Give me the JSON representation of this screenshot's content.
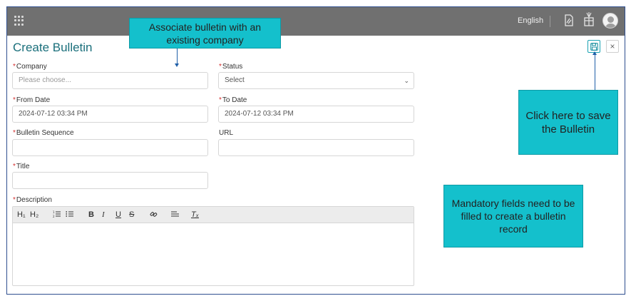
{
  "header": {
    "language": "English"
  },
  "page": {
    "title": "Create Bulletin"
  },
  "form": {
    "company": {
      "label": "Company",
      "placeholder": "Please choose..."
    },
    "status": {
      "label": "Status",
      "value": "Select"
    },
    "from_date": {
      "label": "From Date",
      "value": "2024-07-12 03:34 PM"
    },
    "to_date": {
      "label": "To Date",
      "value": "2024-07-12 03:34 PM"
    },
    "bulletin_sequence": {
      "label": "Bulletin Sequence",
      "value": ""
    },
    "url": {
      "label": "URL",
      "value": ""
    },
    "title": {
      "label": "Title",
      "value": ""
    },
    "description": {
      "label": "Description",
      "value": ""
    },
    "required_mark": "*"
  },
  "editor_toolbar": {
    "h1": "H₁",
    "h2": "H₂",
    "ordered_list": "☰",
    "bullet_list": "☰",
    "bold": "B",
    "italic": "I",
    "underline": "U",
    "strike": "S",
    "link": "🔗",
    "align": "≡",
    "clear": "Tₓ"
  },
  "callouts": {
    "company": "Associate bulletin with an existing company",
    "save": "Click here to save the Bulletin",
    "mandatory": "Mandatory fields need to be filled to create a bulletin record"
  },
  "icons": {
    "apps": "apps-grid-icon",
    "document": "document-icon",
    "gift": "gift-icon",
    "avatar": "user-avatar-icon",
    "save": "save-icon",
    "close": "close-icon",
    "dropdown": "chevron-down-icon"
  },
  "colors": {
    "topbar": "#707070",
    "title": "#1a6f7b",
    "required": "#d32f2f",
    "callout": "#14c0cc",
    "arrow": "#1f5fa8"
  }
}
